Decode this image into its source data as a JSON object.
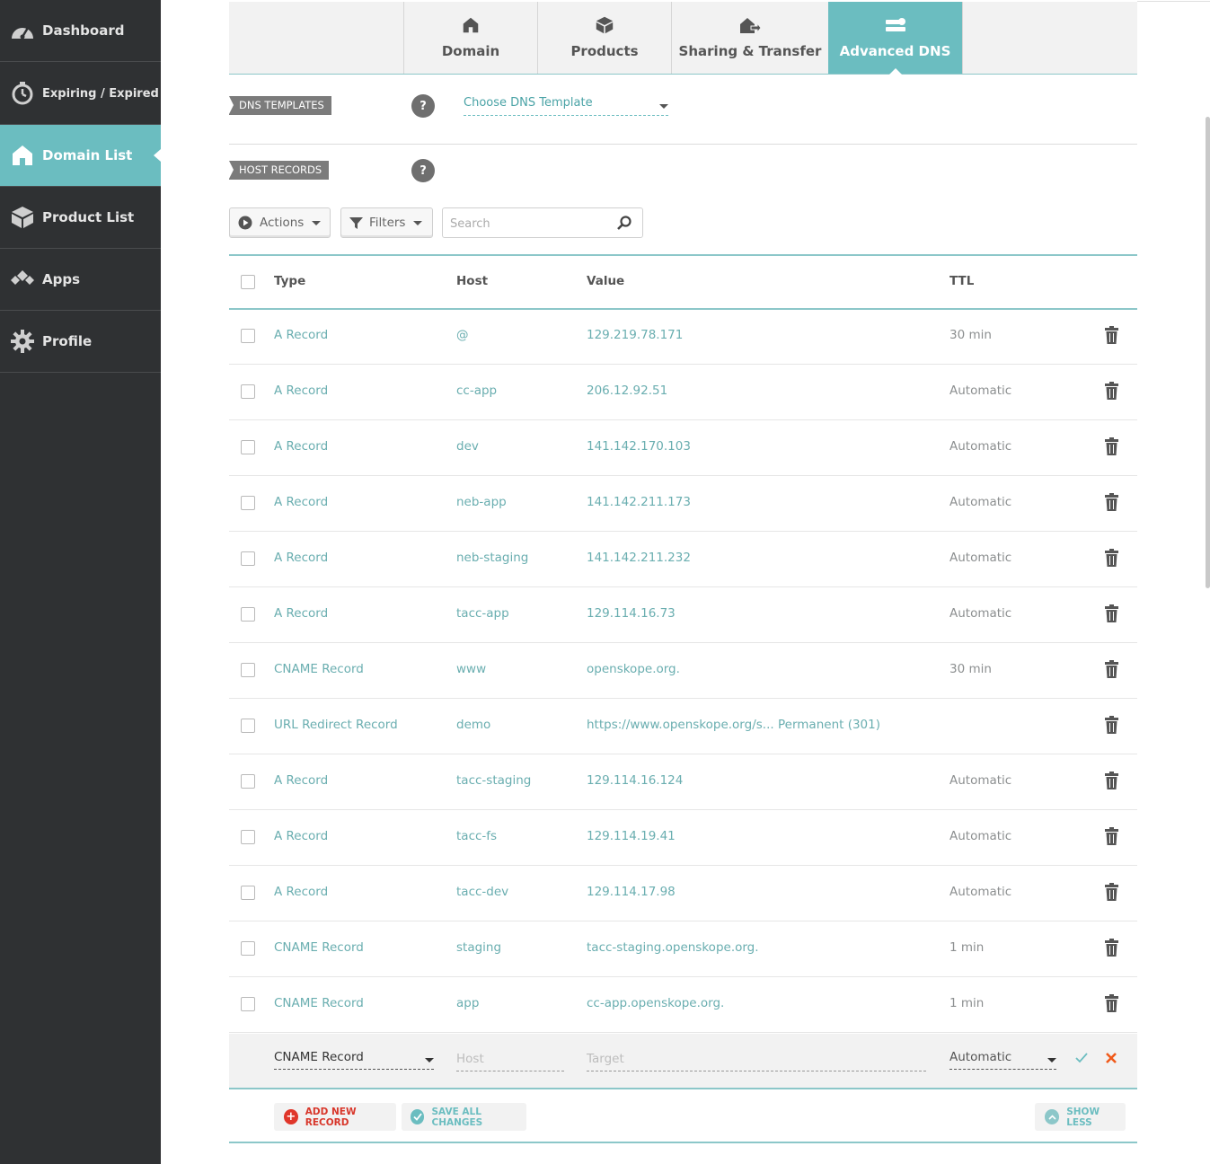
{
  "sidebar": {
    "items": [
      {
        "label": "Dashboard",
        "icon": "speedometer-icon",
        "active": false
      },
      {
        "label": "Expiring / Expired",
        "icon": "timer-icon",
        "active": false
      },
      {
        "label": "Domain List",
        "icon": "home-icon",
        "active": true
      },
      {
        "label": "Product List",
        "icon": "box-icon",
        "active": false
      },
      {
        "label": "Apps",
        "icon": "apps-icon",
        "active": false
      },
      {
        "label": "Profile",
        "icon": "gear-icon",
        "active": false
      }
    ]
  },
  "tabs": [
    {
      "label": "Domain",
      "icon": "home-icon"
    },
    {
      "label": "Products",
      "icon": "box-icon"
    },
    {
      "label": "Sharing & Transfer",
      "icon": "transfer-icon"
    },
    {
      "label": "Advanced DNS",
      "icon": "dns-icon",
      "active": true
    }
  ],
  "dns_templates": {
    "label": "DNS TEMPLATES",
    "help": "?",
    "select_value": "Choose DNS Template"
  },
  "host_records": {
    "label": "HOST RECORDS",
    "help": "?"
  },
  "toolbar": {
    "actions_label": "Actions",
    "filters_label": "Filters",
    "search_placeholder": "Search"
  },
  "table": {
    "headers": {
      "type": "Type",
      "host": "Host",
      "value": "Value",
      "ttl": "TTL"
    },
    "rows": [
      {
        "type": "A Record",
        "host": "@",
        "value": "129.219.78.171",
        "ttl": "30 min"
      },
      {
        "type": "A Record",
        "host": "cc-app",
        "value": "206.12.92.51",
        "ttl": "Automatic"
      },
      {
        "type": "A Record",
        "host": "dev",
        "value": "141.142.170.103",
        "ttl": "Automatic"
      },
      {
        "type": "A Record",
        "host": "neb-app",
        "value": "141.142.211.173",
        "ttl": "Automatic"
      },
      {
        "type": "A Record",
        "host": "neb-staging",
        "value": "141.142.211.232",
        "ttl": "Automatic"
      },
      {
        "type": "A Record",
        "host": "tacc-app",
        "value": "129.114.16.73",
        "ttl": "Automatic"
      },
      {
        "type": "CNAME Record",
        "host": "www",
        "value": "openskope.org.",
        "ttl": "30 min"
      },
      {
        "type": "URL Redirect Record",
        "host": "demo",
        "value": "https://www.openskope.org/s...",
        "extra": "Permanent (301)",
        "ttl": ""
      },
      {
        "type": "A Record",
        "host": "tacc-staging",
        "value": "129.114.16.124",
        "ttl": "Automatic"
      },
      {
        "type": "A Record",
        "host": "tacc-fs",
        "value": "129.114.19.41",
        "ttl": "Automatic"
      },
      {
        "type": "A Record",
        "host": "tacc-dev",
        "value": "129.114.17.98",
        "ttl": "Automatic"
      },
      {
        "type": "CNAME Record",
        "host": "staging",
        "value": "tacc-staging.openskope.org.",
        "ttl": "1 min"
      },
      {
        "type": "CNAME Record",
        "host": "app",
        "value": "cc-app.openskope.org.",
        "ttl": "1 min"
      }
    ]
  },
  "new_record": {
    "type_value": "CNAME Record",
    "host_placeholder": "Host",
    "target_placeholder": "Target",
    "ttl_value": "Automatic"
  },
  "footer": {
    "add_label": "ADD NEW RECORD",
    "save_label": "SAVE ALL CHANGES",
    "show_less_label": "SHOW LESS"
  },
  "colors": {
    "accent": "#6bbdc0",
    "sidebar_bg": "#2f3133",
    "danger": "#e0362a",
    "cancel": "#f05a1a"
  }
}
